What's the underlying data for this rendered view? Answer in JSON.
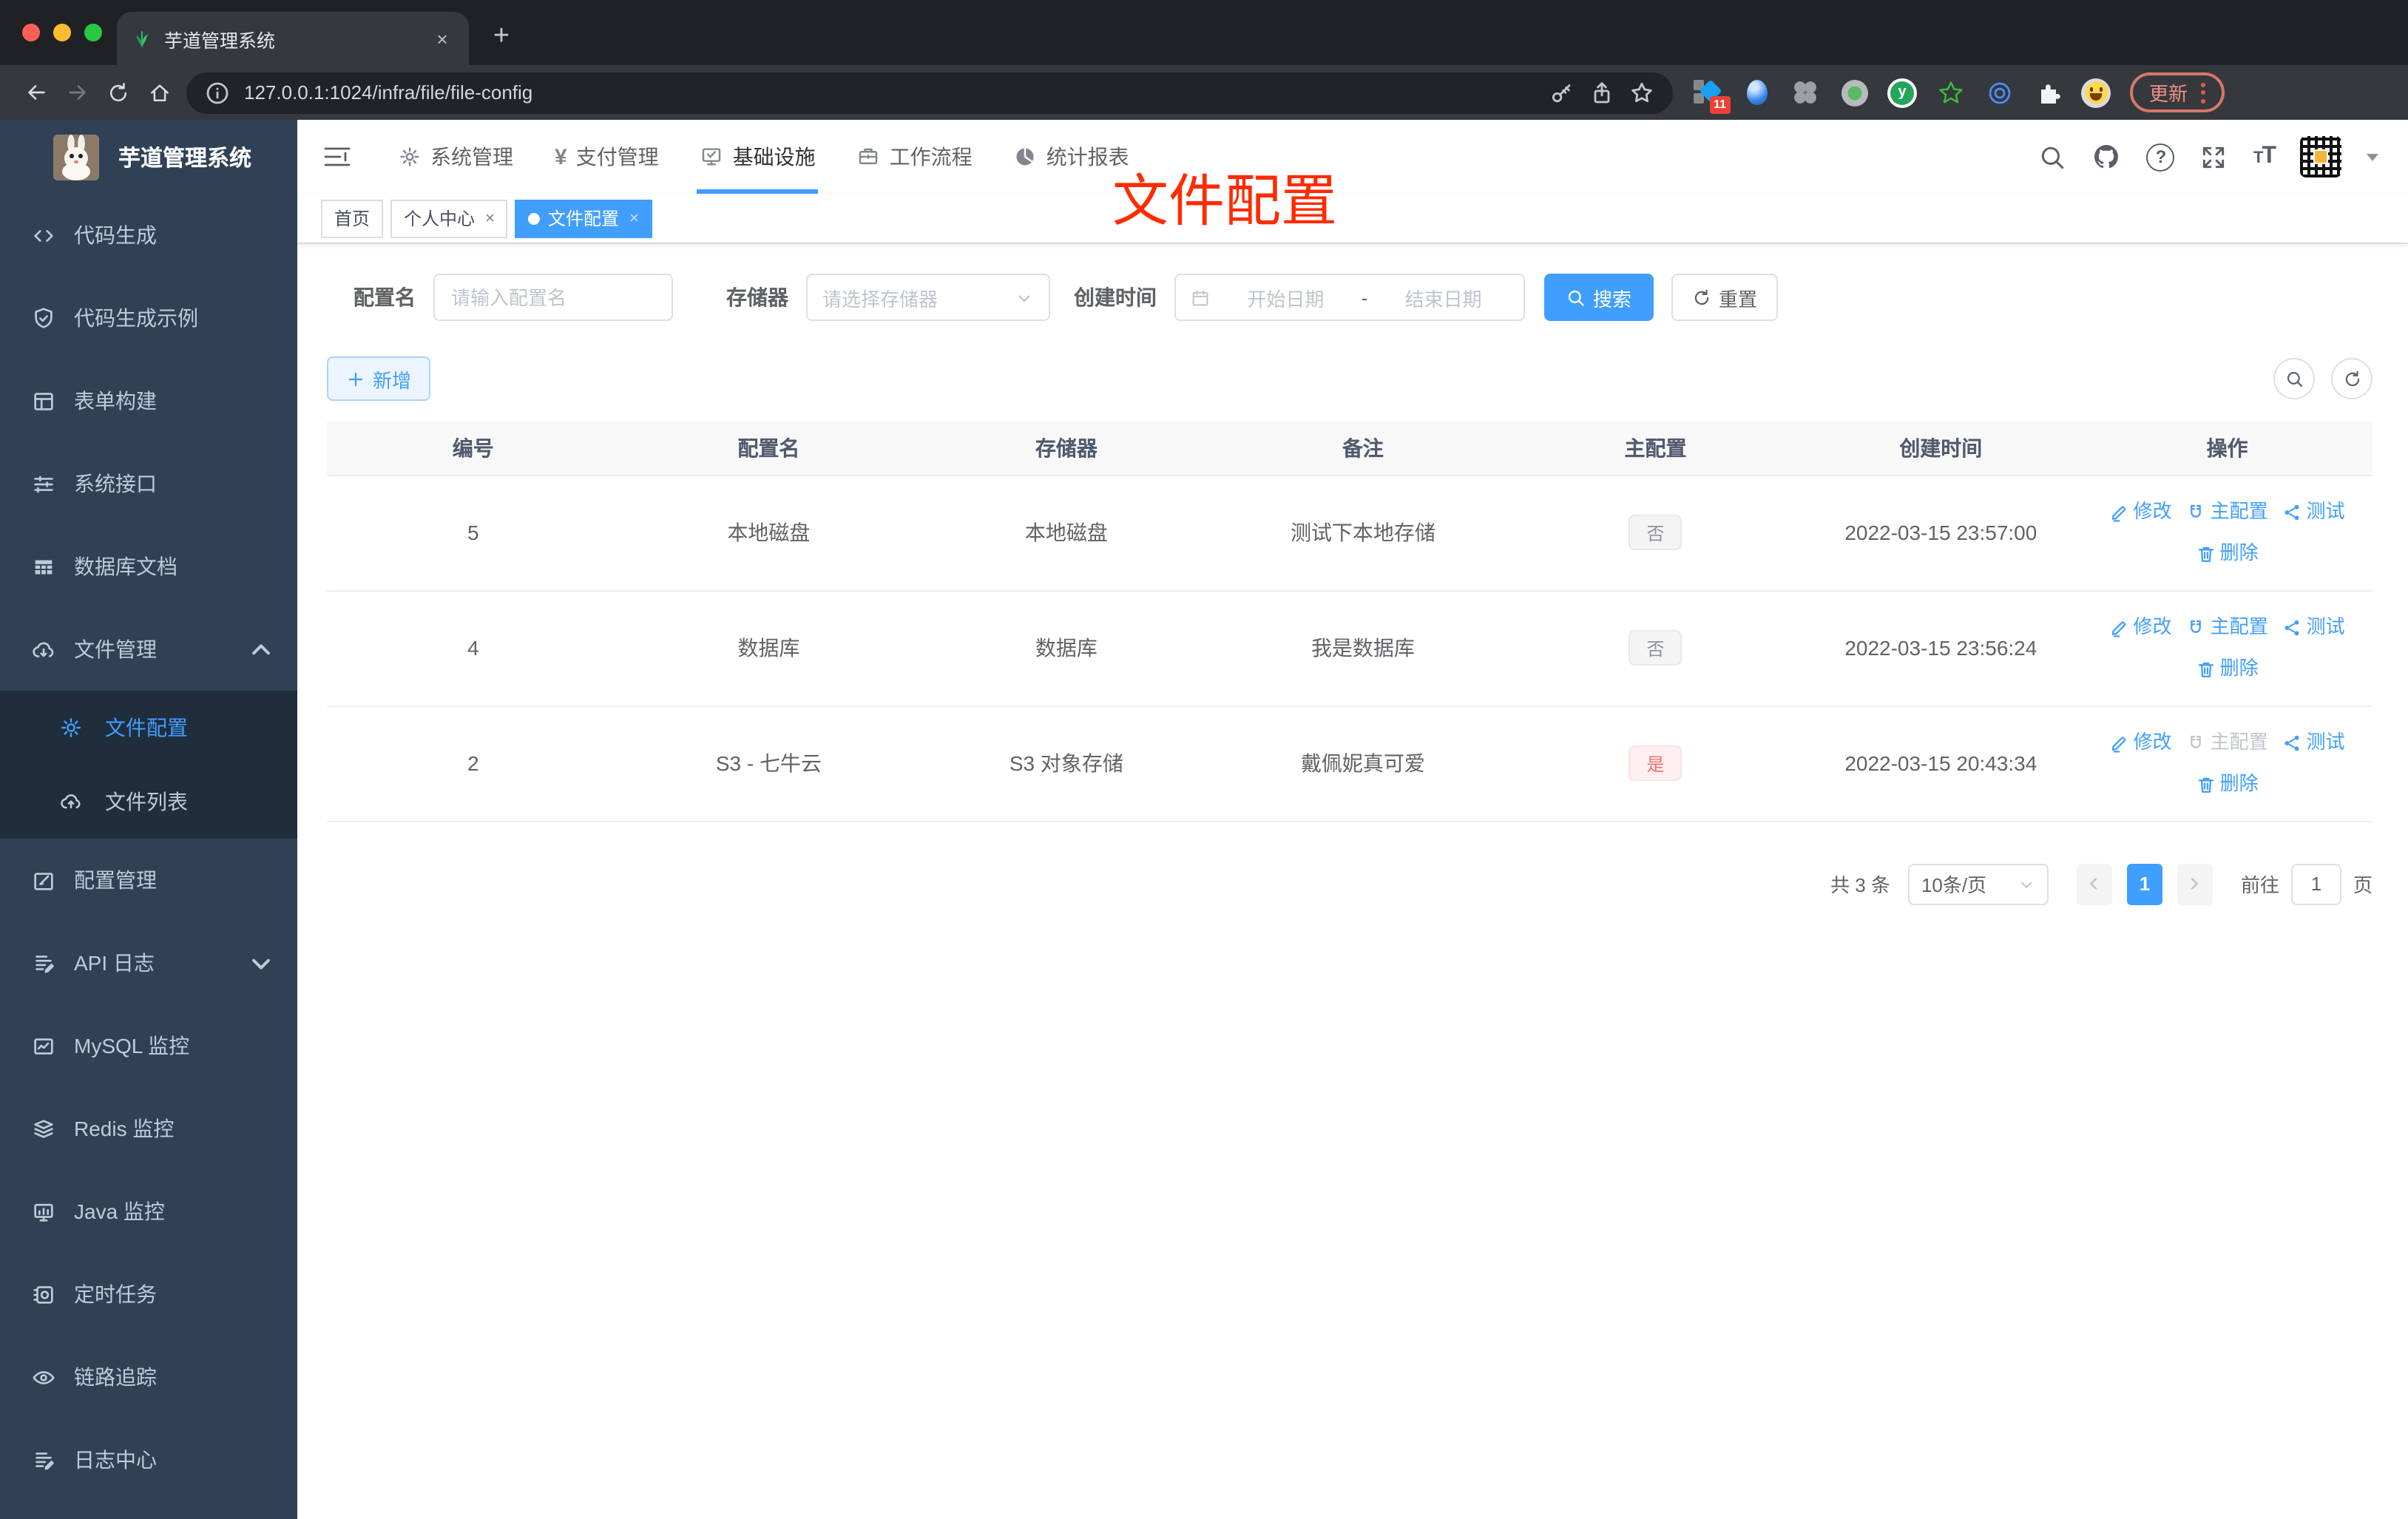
{
  "browser": {
    "tab_title": "芋道管理系统",
    "url": "127.0.0.1:1024/infra/file/file-config",
    "extension_badge": "11",
    "update_label": "更新"
  },
  "icons": {
    "close": "×",
    "plus": "+",
    "question": "?",
    "yen": "¥",
    "github_letter": "y",
    "font_size_small": "T",
    "font_size_big": "T"
  },
  "sidebar": {
    "title": "芋道管理系统",
    "items": [
      {
        "label": "代码生成"
      },
      {
        "label": "代码生成示例"
      },
      {
        "label": "表单构建"
      },
      {
        "label": "系统接口"
      },
      {
        "label": "数据库文档"
      },
      {
        "label": "文件管理"
      },
      {
        "label": "文件配置"
      },
      {
        "label": "文件列表"
      },
      {
        "label": "配置管理"
      },
      {
        "label": "API 日志"
      },
      {
        "label": "MySQL 监控"
      },
      {
        "label": "Redis 监控"
      },
      {
        "label": "Java 监控"
      },
      {
        "label": "定时任务"
      },
      {
        "label": "链路追踪"
      },
      {
        "label": "日志中心"
      }
    ]
  },
  "topnav": {
    "items": [
      {
        "label": "系统管理"
      },
      {
        "label": "支付管理"
      },
      {
        "label": "基础设施"
      },
      {
        "label": "工作流程"
      },
      {
        "label": "统计报表"
      }
    ]
  },
  "tags": {
    "items": [
      {
        "label": "首页"
      },
      {
        "label": "个人中心"
      },
      {
        "label": "文件配置"
      }
    ]
  },
  "overlay": {
    "title": "文件配置"
  },
  "filters": {
    "name_label": "配置名",
    "name_placeholder": "请输入配置名",
    "storage_label": "存储器",
    "storage_placeholder": "请选择存储器",
    "time_label": "创建时间",
    "start_placeholder": "开始日期",
    "range_separator": "-",
    "end_placeholder": "结束日期",
    "search_label": "搜索",
    "reset_label": "重置"
  },
  "toolbar": {
    "add_label": "新增"
  },
  "table": {
    "columns": [
      "编号",
      "配置名",
      "存储器",
      "备注",
      "主配置",
      "创建时间",
      "操作"
    ],
    "action_labels": {
      "edit": "修改",
      "master": "主配置",
      "test": "测试",
      "delete": "删除"
    },
    "rows": [
      {
        "id": "5",
        "name": "本地磁盘",
        "storage": "本地磁盘",
        "remark": "测试下本地存储",
        "master": "否",
        "time": "2022-03-15 23:57:00"
      },
      {
        "id": "4",
        "name": "数据库",
        "storage": "数据库",
        "remark": "我是数据库",
        "master": "否",
        "time": "2022-03-15 23:56:24"
      },
      {
        "id": "2",
        "name": "S3 - 七牛云",
        "storage": "S3 对象存储",
        "remark": "戴佩妮真可爱",
        "master": "是",
        "time": "2022-03-15 20:43:34"
      }
    ]
  },
  "pagination": {
    "total": "共 3 条",
    "size": "10条/页",
    "page": "1",
    "goto_label": "前往",
    "goto_value": "1",
    "unit": "页"
  },
  "colors": {
    "accent": "#409eff",
    "danger_tag": "#f56c6c",
    "overlay_red": "#ff2b00",
    "sidebar_bg": "#304156",
    "submenu_bg": "#1f2d3d"
  }
}
